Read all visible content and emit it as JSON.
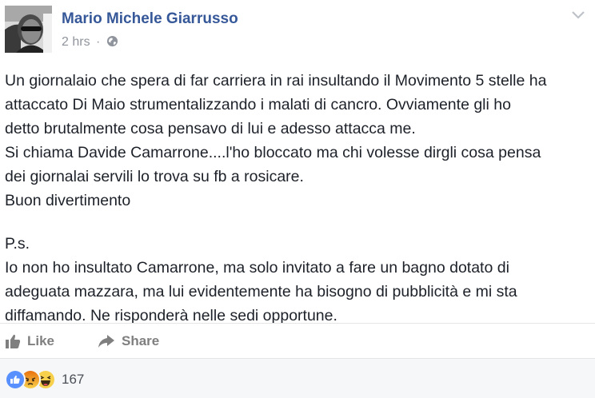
{
  "post": {
    "author": "Mario Michele Giarrusso",
    "time": "2 hrs",
    "separator": "·",
    "privacy_icon": "globe-icon",
    "menu_icon": "chevron-down-icon",
    "lines": [
      "Un giornalaio che spera di far carriera in rai insultando il Movimento 5 stelle ha",
      "attaccato Di Maio strumentalizzando i malati di cancro. Ovviamente gli ho",
      "detto brutalmente cosa pensavo di lui e adesso attacca me.",
      "Si chiama Davide Camarrone....l'ho bloccato ma chi volesse dirgli cosa pensa",
      "dei giornalai servili lo trova su fb a rosicare.",
      "Buon divertimento"
    ],
    "ps_lines": [
      "P.s.",
      "Io non ho insultato Camarrone, ma solo invitato a fare un bagno dotato di",
      "adeguata mazzara, ma lui evidentemente ha bisogno di pubblicità e mi sta",
      "diffamando. Ne risponderà nelle sedi opportune."
    ]
  },
  "actions": {
    "like_label": "Like",
    "share_label": "Share"
  },
  "reactions": {
    "types": [
      "like-icon",
      "angry-icon",
      "haha-icon"
    ],
    "count": "167"
  },
  "colors": {
    "author_link": "#365899",
    "like_blue": "#5890ff",
    "reaction_yellow": "#f7d14c",
    "angry_orange": "#e9710f"
  }
}
